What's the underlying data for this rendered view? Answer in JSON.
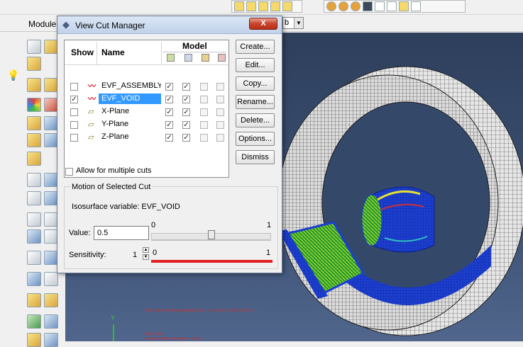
{
  "app": {
    "module_label": "Module",
    "combo_tail": "b"
  },
  "dialog": {
    "title": "View Cut Manager",
    "close_symbol": "X",
    "columns": {
      "show": "Show",
      "name": "Name",
      "model": "Model"
    },
    "rows": [
      {
        "name": "EVF_ASSEMBLY_V",
        "icon": "evf-wave-icon",
        "show": false,
        "model": [
          true,
          true,
          false,
          false
        ],
        "selected": false
      },
      {
        "name": "EVF_VOID",
        "icon": "evf-wave-icon",
        "show": true,
        "model": [
          true,
          true,
          false,
          false
        ],
        "selected": true
      },
      {
        "name": "X-Plane",
        "icon": "plane-icon",
        "show": false,
        "model": [
          true,
          true,
          false,
          false
        ],
        "selected": false
      },
      {
        "name": "Y-Plane",
        "icon": "plane-icon",
        "show": false,
        "model": [
          true,
          true,
          false,
          false
        ],
        "selected": false
      },
      {
        "name": "Z-Plane",
        "icon": "plane-icon",
        "show": false,
        "model": [
          true,
          true,
          false,
          false
        ],
        "selected": false
      }
    ],
    "buttons": {
      "create": "Create...",
      "edit": "Edit...",
      "copy": "Copy...",
      "rename": "Rename...",
      "delete": "Delete...",
      "options": "Options...",
      "dismiss": "Dismiss"
    },
    "allow_multiple": "Allow for multiple cuts",
    "motion": {
      "title": "Motion of Selected Cut",
      "isosurface": "Isosurface variable:  EVF_VOID",
      "value_label": "Value:",
      "value": "0.5",
      "slider_min": "0",
      "slider_max": "1",
      "slider_position": 0.5,
      "sensitivity_label": "Sensitivity:",
      "sensitivity_value": "1",
      "sensitivity_min": "0",
      "sensitivity_max": "1"
    }
  },
  "colors": {
    "selection": "#3399ff",
    "sensitivity_bar": "#e02222",
    "mesh_blue": "#1c3fd0",
    "mesh_green": "#30c030",
    "viewport_top": "#2e3f5c"
  }
}
